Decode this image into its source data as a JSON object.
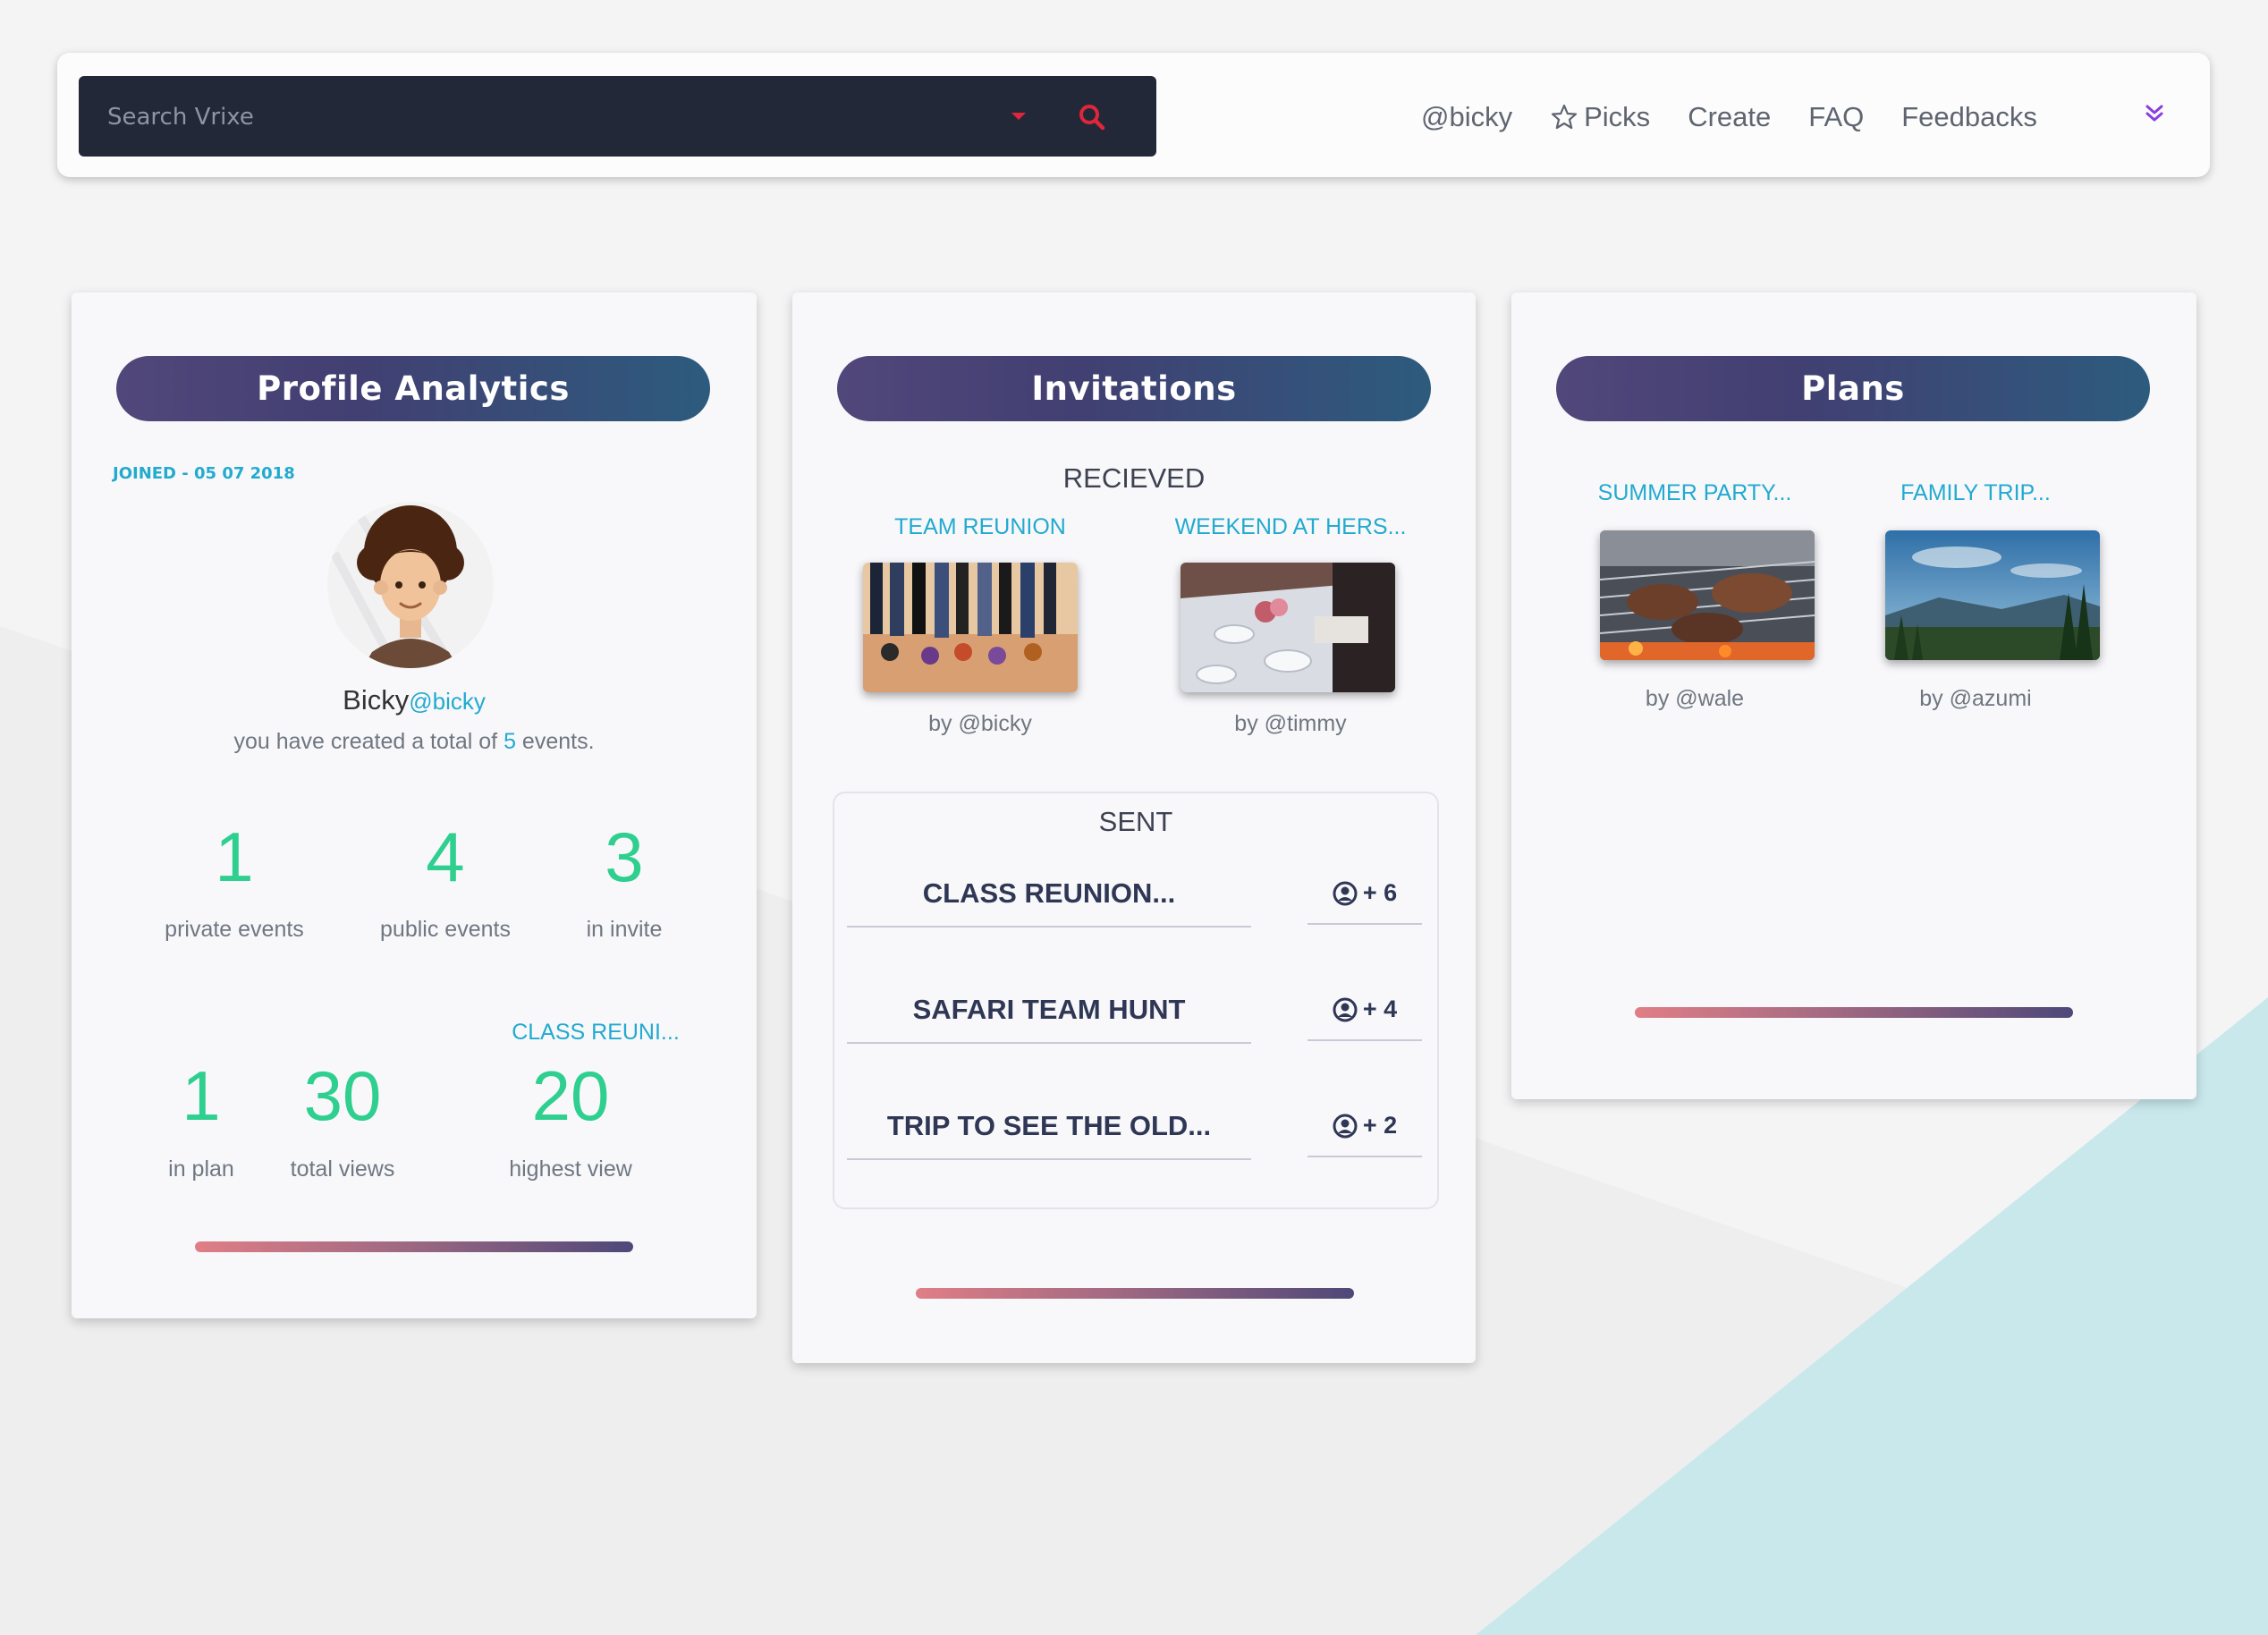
{
  "navbar": {
    "search": {
      "placeholder": "Search Vrixe"
    },
    "links": [
      "@bicky",
      "Picks",
      "Create",
      "FAQ",
      "Feedbacks"
    ]
  },
  "colors": {
    "accent_cyan": "#22aacf",
    "stat_green": "#2ecf8f",
    "header_gradient": [
      "#51477a",
      "#2d5b7e"
    ],
    "search_icon": "#e0263a",
    "chevron": "#8a3de0"
  },
  "profile": {
    "title": "Profile Analytics",
    "joined": "JOINED - 05 07 2018",
    "name": "Bicky",
    "handle": "@bicky",
    "created_prefix": "you have created a total of",
    "created_count": "5",
    "created_suffix": "events.",
    "stats_top": [
      {
        "value": "1",
        "label": "private events"
      },
      {
        "value": "4",
        "label": "public events"
      },
      {
        "value": "3",
        "label": "in invite"
      }
    ],
    "top_event": "CLASS REUNI...",
    "stats_bottom": [
      {
        "value": "1",
        "label": "in plan"
      },
      {
        "value": "30",
        "label": "total views"
      },
      {
        "value": "20",
        "label": "highest view"
      }
    ]
  },
  "invitations": {
    "title": "Invitations",
    "received_label": "RECIEVED",
    "received": [
      {
        "title": "TEAM REUNION",
        "by": "by @bicky"
      },
      {
        "title": "WEEKEND AT HERS...",
        "by": "by @timmy"
      }
    ],
    "sent_label": "SENT",
    "sent": [
      {
        "title": "CLASS REUNION...",
        "count": "+ 6"
      },
      {
        "title": "SAFARI TEAM HUNT",
        "count": "+ 4"
      },
      {
        "title": "TRIP TO SEE THE OLD...",
        "count": "+ 2"
      }
    ]
  },
  "plans": {
    "title": "Plans",
    "items": [
      {
        "title": "SUMMER PARTY...",
        "by": "by @wale"
      },
      {
        "title": "FAMILY TRIP...",
        "by": "by @azumi"
      }
    ]
  }
}
